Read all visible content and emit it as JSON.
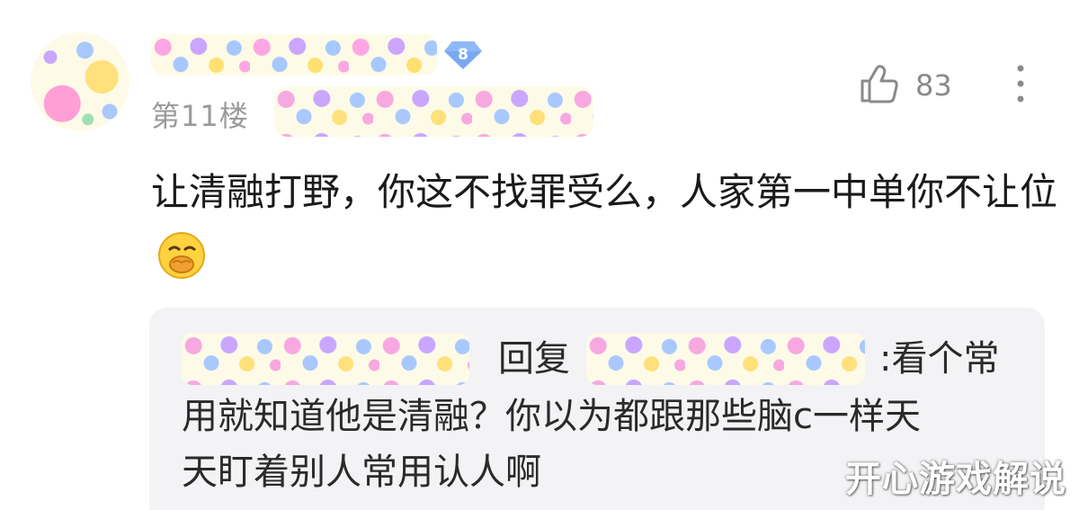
{
  "comment": {
    "floor_label": "第11楼",
    "level": "8",
    "like_count": "83",
    "text": "让清融打野，你这不找罪受么，人家第一中单你不让位",
    "emoji_icon": "covering-mouth-laugh-emoji"
  },
  "reply": {
    "reply_word": "回复",
    "line1_tail": ":看个常",
    "line2": "用就知道他是清融？你以为都跟那些脑c一样天",
    "line3": "天盯着别人常用认人啊"
  },
  "watermark": "开心游戏解说",
  "colors": {
    "badge": "#7aa8f0",
    "meta_text": "#9a9a9a",
    "reply_bg": "#f3f3f5"
  }
}
